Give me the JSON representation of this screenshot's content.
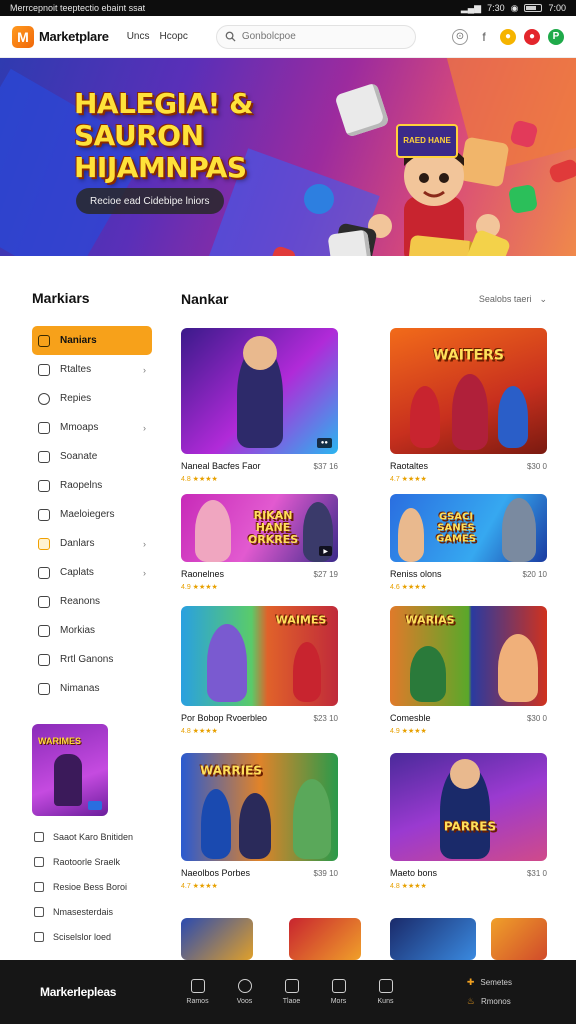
{
  "status_bar": {
    "left_text": "Merrcepnoit teeptectio ebaint ssat",
    "right_items": [
      "7:30",
      "7:00"
    ]
  },
  "header": {
    "logo_letter": "M",
    "brand": "Marketplare",
    "nav": [
      "Uncs",
      "Hcopc"
    ],
    "search_placeholder": "Gonbolcpoe"
  },
  "hero": {
    "title": "HALEGIA! &\nSAURON\nHIJAMNPAS",
    "subtitle": "Recioe ead Cidebipe lniors",
    "sign_text": "RAED\nHANE"
  },
  "sidebar": {
    "title": "Markiars",
    "items": [
      {
        "label": "Naniars",
        "chevron": false,
        "active": true
      },
      {
        "label": "Rtaltes",
        "chevron": true,
        "active": false
      },
      {
        "label": "Repies",
        "chevron": false,
        "active": false
      },
      {
        "label": "Mmoaps",
        "chevron": true,
        "active": false
      },
      {
        "label": "Soanate",
        "chevron": false,
        "active": false
      },
      {
        "label": "Raopelns",
        "chevron": false,
        "active": false
      },
      {
        "label": "Maeloiegers",
        "chevron": false,
        "active": false
      },
      {
        "label": "Danlars",
        "chevron": true,
        "active": false
      },
      {
        "label": "Caplats",
        "chevron": true,
        "active": false
      },
      {
        "label": "Reanons",
        "chevron": false,
        "active": false
      },
      {
        "label": "Morkias",
        "chevron": false,
        "active": false
      },
      {
        "label": "Rrtl Ganons",
        "chevron": false,
        "active": false
      },
      {
        "label": "Nimanas",
        "chevron": false,
        "active": false
      }
    ],
    "promo_text": "WARIMES",
    "links": [
      "Saaot Karo Bnitiden",
      "Raotoorle Sraelk",
      "Resioe Bess Boroi",
      "Nmasesterdais",
      "Sciselslor loed"
    ]
  },
  "main": {
    "title": "Nankar",
    "sort_label": "Sealobs taeri",
    "sort_icon": "chevron-down-icon",
    "cards": [
      {
        "title": "Naneal Bacfes Faor",
        "price": "$37 16",
        "rating": "4.8 ★★★★",
        "thumb_text": "",
        "chip": "●●"
      },
      {
        "title": "Raotaltes",
        "price": "$30 0",
        "rating": "4.7 ★★★★",
        "thumb_text": "WAITERS",
        "chip": ""
      },
      {
        "title": "Raonelnes",
        "price": "$27 19",
        "rating": "4.9 ★★★★",
        "thumb_text": "RIKAN\nHANE\nORKRES",
        "chip": "▶"
      },
      {
        "title": "Reniss olons",
        "price": "$20 10",
        "rating": "4.6 ★★★★",
        "thumb_text": "GSACI\nSANES\nGAMES",
        "chip": ""
      },
      {
        "title": "Por Bobop Rvoerbleo",
        "price": "$23 10",
        "rating": "4.8 ★★★★",
        "thumb_text": "WAIMES",
        "chip": ""
      },
      {
        "title": "Comesble",
        "price": "$30 0",
        "rating": "4.9 ★★★★",
        "thumb_text": "WARIAS",
        "chip": ""
      },
      {
        "title": "Naeolbos Porbes",
        "price": "$39 10",
        "rating": "4.7 ★★★★",
        "thumb_text": "WARRIES",
        "chip": ""
      },
      {
        "title": "Maeto bons",
        "price": "$31 0",
        "rating": "4.8 ★★★★",
        "thumb_text": "PARRES",
        "chip": ""
      }
    ]
  },
  "bottom_bar": {
    "brand": "Markerlepleas",
    "nav": [
      "Ramos",
      "Voos",
      "Tlaoe",
      "Mors",
      "Kuns"
    ],
    "right": [
      {
        "label": "Semetes",
        "icon": "gamepad-icon"
      },
      {
        "label": "Rmonos",
        "icon": "flame-icon"
      }
    ]
  },
  "colors": {
    "accent": "#f7a11a",
    "bottom_bar": "#161616"
  }
}
